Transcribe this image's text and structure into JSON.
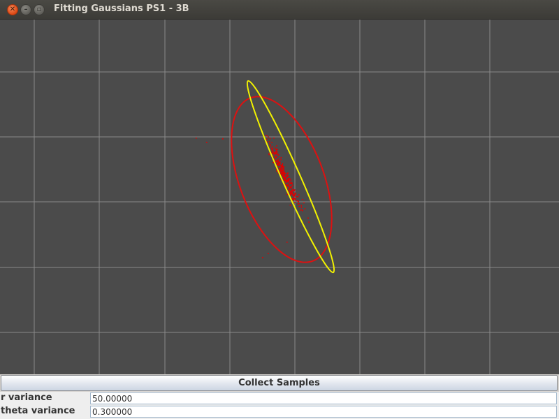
{
  "window": {
    "title": "Fitting Gaussians PS1 - 3B",
    "controls": [
      {
        "icon": "close-icon",
        "glyph": "✕"
      },
      {
        "icon": "minimize-icon",
        "glyph": "–"
      },
      {
        "icon": "maximize-icon",
        "glyph": "▫"
      }
    ]
  },
  "plot": {
    "background": "#4b4b4b",
    "grid_color": "#8a8a8a",
    "sample_color": "#e00000",
    "red_ellipse_color": "#dd1111",
    "yellow_ellipse_color": "#f2f200"
  },
  "controls": {
    "collect_button": "Collect Samples",
    "r_variance": {
      "label": "r variance",
      "value": "50.00000"
    },
    "theta_variance": {
      "label": "theta variance",
      "value": "0.300000"
    }
  }
}
